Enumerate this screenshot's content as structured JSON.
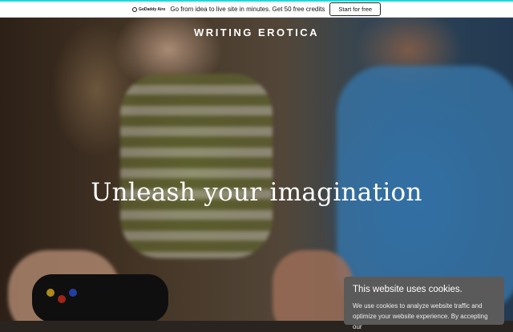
{
  "promo": {
    "logo_text": "GoDaddy Airo",
    "message": "Go from idea to live site in minutes. Get 50 free credits",
    "cta_label": "Start for free"
  },
  "site": {
    "title": "WRITING EROTICA",
    "tagline": "Unleash your imagination"
  },
  "cookie_banner": {
    "title": "This website uses cookies.",
    "body": "We use cookies to analyze website traffic and optimize your website experience. By accepting our"
  },
  "colors": {
    "promo_accent": "#1bdbdb",
    "cookie_bg": "#5a5a5a"
  }
}
